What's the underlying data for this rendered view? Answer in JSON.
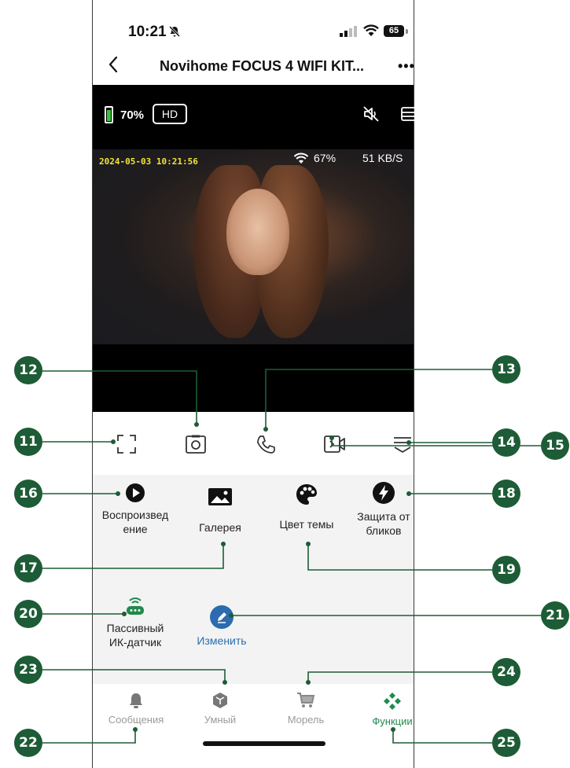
{
  "status_bar": {
    "time": "10:21",
    "battery": "65"
  },
  "nav": {
    "title": "Novihome FOCUS 4 WIFI KIT...",
    "more": "•••"
  },
  "video": {
    "battery_pct": "70%",
    "quality": "HD",
    "timestamp": "2024-05-03 10:21:56",
    "wifi_pct": "67%",
    "bitrate": "51 KB/S"
  },
  "controls": [
    "fullscreen-icon",
    "snapshot-icon",
    "call-icon",
    "record-icon",
    "collapse-icon"
  ],
  "functions": [
    {
      "label_1": "Воспроизвед",
      "label_2": "ение",
      "icon": "play-icon"
    },
    {
      "label_1": "Галерея",
      "label_2": "",
      "icon": "gallery-icon"
    },
    {
      "label_1": "Цвет темы",
      "label_2": "",
      "icon": "palette-icon"
    },
    {
      "label_1": "Защита от",
      "label_2": "бликов",
      "icon": "flash-icon"
    },
    {
      "label_1": "Пассивный",
      "label_2": "ИК-датчик",
      "icon": "pir-sensor-icon"
    },
    {
      "label_1": "Изменить",
      "label_2": "",
      "icon": "edit-icon"
    }
  ],
  "tabs": [
    {
      "label": "Сообщения",
      "icon": "bell-icon"
    },
    {
      "label": "Умный",
      "icon": "cube-icon"
    },
    {
      "label": "Морель",
      "icon": "cart-icon"
    },
    {
      "label": "Функции",
      "icon": "diamond-icon"
    }
  ],
  "callouts": [
    "11",
    "12",
    "13",
    "14",
    "15",
    "16",
    "17",
    "18",
    "19",
    "20",
    "21",
    "22",
    "23",
    "24",
    "25"
  ],
  "colors": {
    "accent": "#1f8a4d",
    "callout": "#1d5c36",
    "timestamp": "#f4e23a",
    "link": "#2b6cb0"
  }
}
